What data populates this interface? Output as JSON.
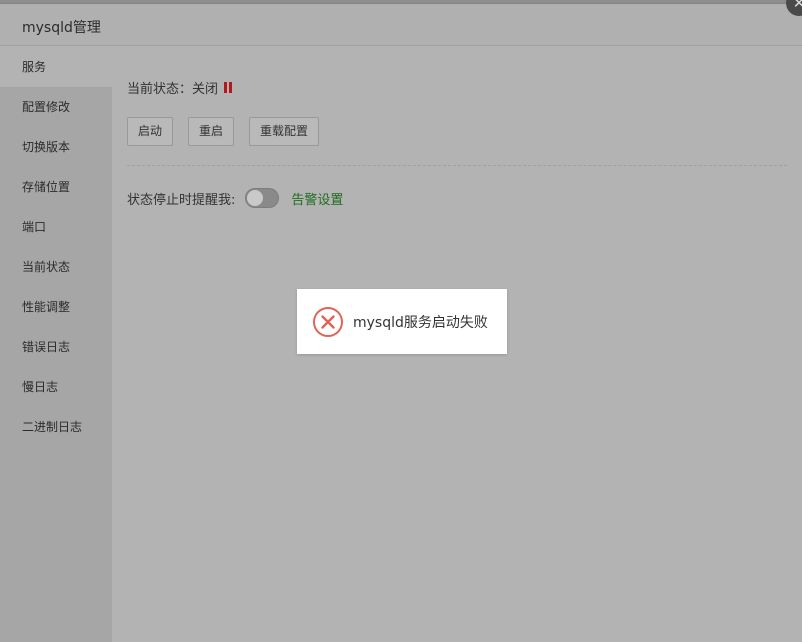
{
  "window": {
    "title": "mysqld管理"
  },
  "sidebar": {
    "items": [
      {
        "label": "服务",
        "active": true
      },
      {
        "label": "配置修改"
      },
      {
        "label": "切换版本"
      },
      {
        "label": "存储位置"
      },
      {
        "label": "端口"
      },
      {
        "label": "当前状态"
      },
      {
        "label": "性能调整"
      },
      {
        "label": "错误日志"
      },
      {
        "label": "慢日志"
      },
      {
        "label": "二进制日志"
      }
    ]
  },
  "service": {
    "status_label": "当前状态：",
    "status_value": "关闭",
    "status_icon": "pause-icon",
    "status_color": "#b11a1a",
    "buttons": {
      "start": "启动",
      "restart": "重启",
      "reload": "重载配置"
    },
    "alert_label": "状态停止时提醒我:",
    "alert_enabled": false,
    "alert_link": "告警设置"
  },
  "toast": {
    "icon": "error-circle-icon",
    "message": "mysqld服务启动失败",
    "icon_color": "#e0635a"
  }
}
